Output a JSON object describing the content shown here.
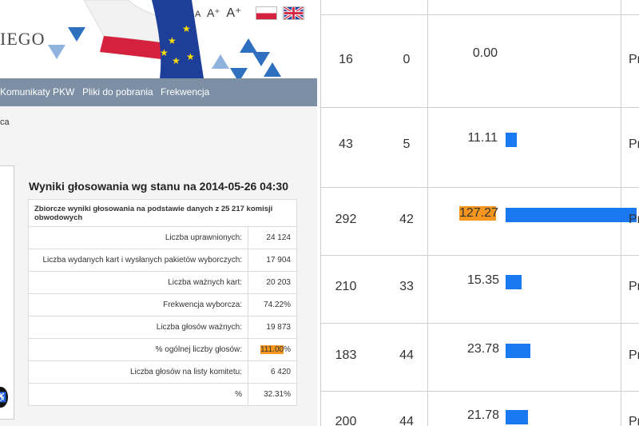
{
  "header": {
    "banner_text": "IEGO",
    "font_sizes": [
      "A",
      "A⁺",
      "A⁺"
    ],
    "flags": [
      "pl-flag",
      "uk-flag"
    ]
  },
  "nav": {
    "items": [
      "Komunikaty PKW",
      "Pliki do pobrania",
      "Frekwencja"
    ]
  },
  "breadcrumb": "ca",
  "results": {
    "title": "Wyniki głosowania wg stanu na 2014-05-26 04:30",
    "header_text": "Zbiorcze wyniki głosowania na podstawie danych z 25 217 komisji obwodowych",
    "rows": [
      {
        "label": "Liczba uprawnionych:",
        "value": "24 124"
      },
      {
        "label": "Liczba wydanych kart i wysłanych pakietów wyborczych:",
        "value": "17 904"
      },
      {
        "label": "Liczba ważnych kart:",
        "value": "20 203"
      },
      {
        "label": "Frekwencja wyborcza:",
        "value": "74.22%"
      },
      {
        "label": "Liczba głosów ważnych:",
        "value": "19 873"
      },
      {
        "label": "% ogólnej liczby głosów:",
        "value_highlight": "111.00",
        "value_suffix": "%"
      },
      {
        "label": "Liczba głosów na listy komitetu:",
        "value": "6 420"
      },
      {
        "label": "%",
        "value": "32.31%"
      }
    ]
  },
  "right_table": {
    "rows": [
      {
        "a": "16",
        "b": "0",
        "pct": "0.00",
        "bar": 0,
        "highlight": false,
        "tail": "Pr"
      },
      {
        "a": "43",
        "b": "5",
        "pct": "11.11",
        "bar": 11.11,
        "highlight": false,
        "tail": "Pr"
      },
      {
        "a": "292",
        "b": "42",
        "pct": "127.27",
        "bar": 127.27,
        "highlight": true,
        "tail": "Pr"
      },
      {
        "a": "210",
        "b": "33",
        "pct": "15.35",
        "bar": 15.35,
        "highlight": false,
        "tail": "Pr"
      },
      {
        "a": "183",
        "b": "44",
        "pct": "23.78",
        "bar": 23.78,
        "highlight": false,
        "tail": "Pr"
      },
      {
        "a": "200",
        "b": "44",
        "pct": "21.78",
        "bar": 21.78,
        "highlight": false,
        "tail": "Pr"
      }
    ]
  },
  "colors": {
    "accent_blue": "#1a78f0",
    "highlight_orange": "#f5961e",
    "nav_bg": "#7c8fa4"
  }
}
